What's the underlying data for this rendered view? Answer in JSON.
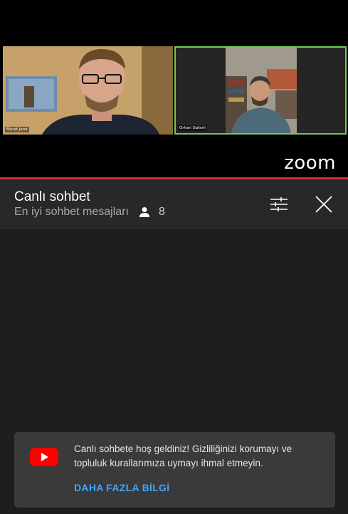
{
  "video": {
    "participants": [
      {
        "name": "Murat Jane"
      },
      {
        "name": "Orhan Gafarli"
      }
    ],
    "logo_text": "zoom"
  },
  "chat": {
    "title": "Canlı sohbet",
    "subtitle": "En iyi sohbet mesajları",
    "viewer_count": "8",
    "icons": {
      "viewers": "person-icon",
      "filter": "tune-icon",
      "close": "close-icon"
    }
  },
  "welcome": {
    "message": "Canlı sohbete hoş geldiniz! Gizliliğinizi korumayı ve topluluk kurallarımıza uymayı ihmal etmeyin.",
    "learn_more": "DAHA FAZLA BİLGİ",
    "icon": "youtube-icon"
  },
  "colors": {
    "accent_red": "#d32f2f",
    "link_blue": "#3ea6ff",
    "speaker_highlight": "#6dd04a"
  }
}
